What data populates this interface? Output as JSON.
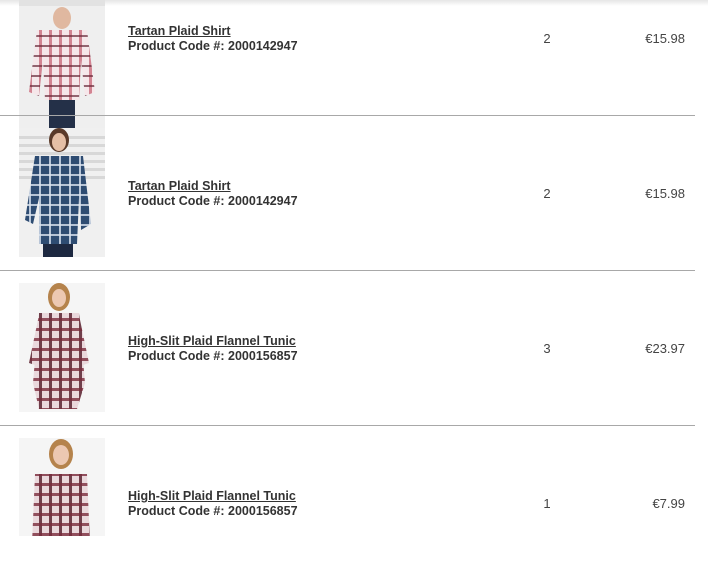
{
  "cart": {
    "items": [
      {
        "title": "Tartan Plaid Shirt",
        "code_label": "Product Code #: 2000142947",
        "quantity": "2",
        "price": "€15.98",
        "image": "pink-plaid-shirt"
      },
      {
        "title": "Tartan Plaid Shirt",
        "code_label": "Product Code #: 2000142947",
        "quantity": "2",
        "price": "€15.98",
        "image": "blue-plaid-shirt"
      },
      {
        "title": "High-Slit Plaid Flannel Tunic",
        "code_label": "Product Code #: 2000156857",
        "quantity": "3",
        "price": "€23.97",
        "image": "red-plaid-tunic"
      },
      {
        "title": "High-Slit Plaid Flannel Tunic",
        "code_label": "Product Code #: 2000156857",
        "quantity": "1",
        "price": "€7.99",
        "image": "red-plaid-tunic"
      }
    ]
  },
  "colors": {
    "divider": "#a8a8a8",
    "text": "#333333",
    "pink_plaid": "#c96b7c",
    "blue_plaid": "#2e4c72",
    "red_plaid": "#5a2431"
  }
}
